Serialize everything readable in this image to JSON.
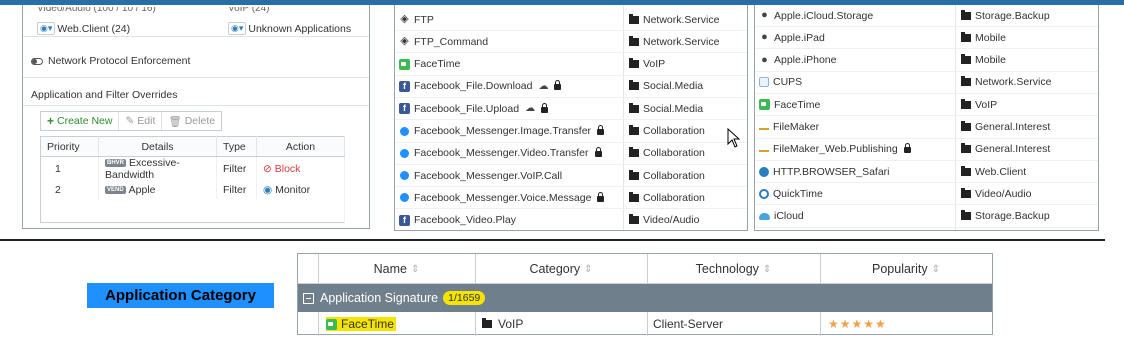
{
  "panel1": {
    "filters": {
      "cut_left": "Video/Audio (100 / 10 / 16)",
      "cut_right": "VoIP (24)",
      "left_label": "Web.Client (24)",
      "right_label": "Unknown Applications"
    },
    "protocol_enforcement": "Network Protocol Enforcement",
    "overrides_title": "Application and Filter Overrides",
    "toolbar": {
      "create": "Create New",
      "edit": "Edit",
      "delete": "Delete"
    },
    "columns": [
      "Priority",
      "Details",
      "Type",
      "Action"
    ],
    "rows": [
      {
        "priority": "1",
        "badge": "BHVR",
        "details": "Excessive-Bandwidth",
        "type": "Filter",
        "action": "Block"
      },
      {
        "priority": "2",
        "badge": "VEND",
        "details": "Apple",
        "type": "Filter",
        "action": "Monitor"
      }
    ]
  },
  "panel2": {
    "rows": [
      {
        "name": "FTP",
        "icon": "ftp-icon",
        "category": "Network.Service"
      },
      {
        "name": "FTP_Command",
        "icon": "ftp-icon",
        "category": "Network.Service"
      },
      {
        "name": "FaceTime",
        "icon": "facetime-icon",
        "category": "VoIP"
      },
      {
        "name": "Facebook_File.Download",
        "icon": "facebook-icon",
        "category": "Social.Media"
      },
      {
        "name": "Facebook_File.Upload",
        "icon": "facebook-icon",
        "category": "Social.Media"
      },
      {
        "name": "Facebook_Messenger.Image.Transfer",
        "icon": "messenger-icon",
        "category": "Collaboration"
      },
      {
        "name": "Facebook_Messenger.Video.Transfer",
        "icon": "messenger-icon",
        "category": "Collaboration"
      },
      {
        "name": "Facebook_Messenger.VoIP.Call",
        "icon": "messenger-icon",
        "category": "Collaboration"
      },
      {
        "name": "Facebook_Messenger.Voice.Message",
        "icon": "messenger-icon",
        "category": "Collaboration"
      },
      {
        "name": "Facebook_Video.Play",
        "icon": "facebook-icon",
        "category": "Video/Audio"
      }
    ]
  },
  "panel3": {
    "rows": [
      {
        "name": "Apple.iCloud.Storage",
        "icon": "apple-icon",
        "category": "Storage.Backup"
      },
      {
        "name": "Apple.iPad",
        "icon": "apple-icon",
        "category": "Mobile"
      },
      {
        "name": "Apple.iPhone",
        "icon": "apple-icon",
        "category": "Mobile"
      },
      {
        "name": "CUPS",
        "icon": "cups-icon",
        "category": "Network.Service"
      },
      {
        "name": "FaceTime",
        "icon": "facetime-icon",
        "category": "VoIP"
      },
      {
        "name": "FileMaker",
        "icon": "filemaker-icon",
        "category": "General.Interest"
      },
      {
        "name": "FileMaker_Web.Publishing",
        "icon": "filemaker-icon",
        "category": "General.Interest"
      },
      {
        "name": "HTTP.BROWSER_Safari",
        "icon": "safari-icon",
        "category": "Web.Client"
      },
      {
        "name": "QuickTime",
        "icon": "quicktime-icon",
        "category": "Video/Audio"
      },
      {
        "name": "iCloud",
        "icon": "icloud-icon",
        "category": "Storage.Backup"
      }
    ]
  },
  "callout": "Application Category",
  "bottom": {
    "columns": [
      "Name",
      "Category",
      "Technology",
      "Popularity"
    ],
    "group": "Application Signature",
    "count": "1/1659",
    "row": {
      "name": "FaceTime",
      "category": "VoIP",
      "technology": "Client-Server",
      "popularity": 5
    }
  }
}
